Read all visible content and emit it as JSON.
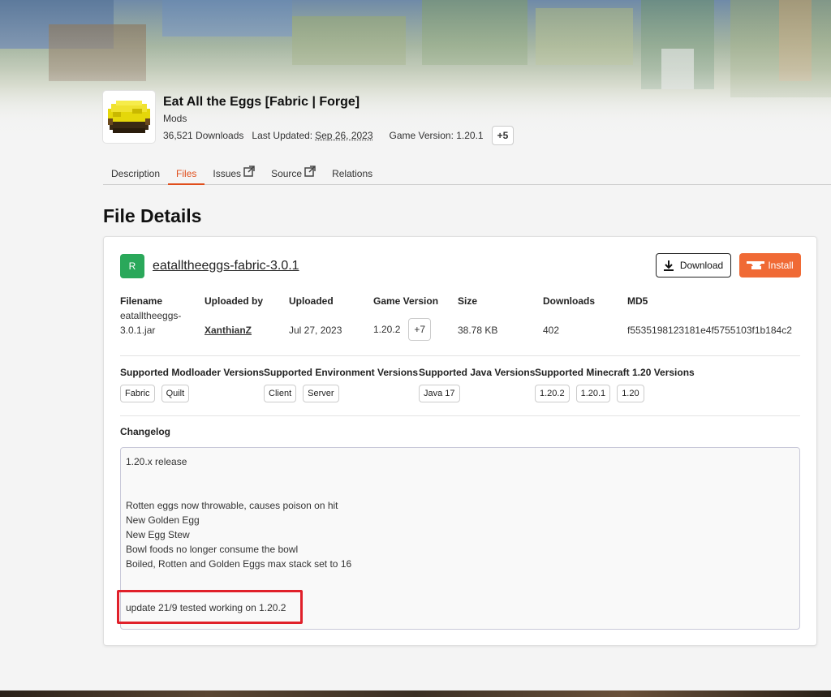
{
  "mod": {
    "title": "Eat All the Eggs [Fabric | Forge]",
    "category": "Mods",
    "downloads": "36,521 Downloads",
    "last_updated_label": "Last Updated:",
    "last_updated_date": "Sep 26, 2023",
    "game_version": "Game Version: 1.20.1",
    "more_versions": "+5"
  },
  "tabs": [
    {
      "label": "Description",
      "active": false
    },
    {
      "label": "Files",
      "active": true
    },
    {
      "label": "Issues",
      "active": false,
      "external": true
    },
    {
      "label": "Source",
      "active": false,
      "external": true
    },
    {
      "label": "Relations",
      "active": false
    }
  ],
  "page_heading": "File Details",
  "file": {
    "release_badge": "R",
    "name": "eatalltheeggs-fabric-3.0.1",
    "download_label": "Download",
    "install_label": "Install",
    "columns": {
      "filename": {
        "header": "Filename",
        "value": "eatalltheeggs-3.0.1.jar"
      },
      "uploaded_by": {
        "header": "Uploaded by",
        "value": "XanthianZ"
      },
      "uploaded": {
        "header": "Uploaded",
        "value": "Jul 27, 2023"
      },
      "game_version": {
        "header": "Game Version",
        "value": "1.20.2",
        "more": "+7"
      },
      "size": {
        "header": "Size",
        "value": "38.78 KB"
      },
      "downloads": {
        "header": "Downloads",
        "value": "402"
      },
      "md5": {
        "header": "MD5",
        "value": "f5535198123181e4f5755103f1b184c2"
      }
    },
    "supported": {
      "modloader": {
        "header": "Supported Modloader Versions",
        "chips": [
          "Fabric",
          "Quilt"
        ]
      },
      "environment": {
        "header": "Supported Environment Versions",
        "chips": [
          "Client",
          "Server"
        ]
      },
      "java": {
        "header": "Supported Java Versions",
        "chips": [
          "Java 17"
        ]
      },
      "minecraft": {
        "header": "Supported Minecraft 1.20 Versions",
        "chips": [
          "1.20.2",
          "1.20.1",
          "1.20"
        ]
      }
    },
    "changelog_header": "Changelog",
    "changelog_lines": [
      "1.20.x release",
      "",
      "",
      "Rotten eggs now throwable, causes poison on hit",
      "New Golden Egg",
      "New Egg Stew",
      "Bowl foods no longer consume the bowl",
      "Boiled, Rotten and Golden Eggs max stack set to 16",
      "",
      "",
      "update 21/9 tested working on 1.20.2"
    ]
  },
  "colors": {
    "accent": "#e04e1b",
    "install_button": "#f06a35",
    "release_badge": "#2aa85a",
    "highlight_box": "#e0202a"
  },
  "icons": [
    "external-link-icon",
    "download-icon",
    "anvil-icon",
    "egg-bowl-logo"
  ]
}
